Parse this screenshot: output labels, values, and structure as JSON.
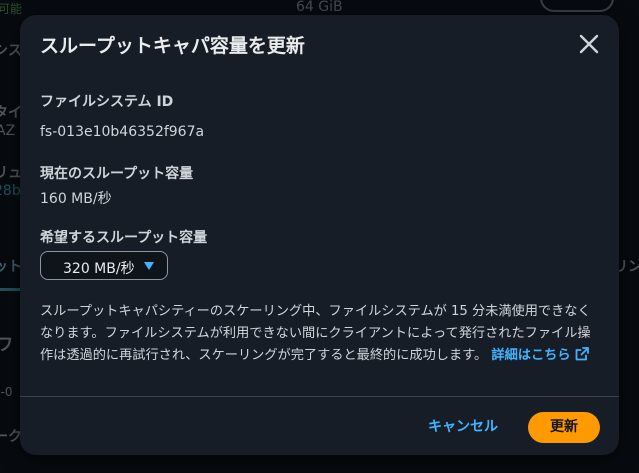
{
  "background": {
    "storage_value": "64 GiB",
    "left_fragments": [
      "可能",
      "シス",
      "タイ",
      "AZ",
      "リュ",
      "28b",
      "ット",
      "ワ",
      "c-0",
      "ーク"
    ],
    "right_fragment": "リン"
  },
  "modal": {
    "title": "スループットキャパ容量を更新",
    "close_label": "×",
    "fs_id_label": "ファイルシステム ID",
    "fs_id_value": "fs-013e10b46352f967a",
    "current_label": "現在のスループット容量",
    "current_value": "160 MB/秒",
    "desired_label": "希望するスループット容量",
    "desired_value": "320 MB/秒",
    "warning_text": "スループットキャパシティーのスケーリング中、ファイルシステムが 15 分未満使用できなくなります。ファイルシステムが利用できない間にクライアントによって発行されたファイル操作は透過的に再試行され、スケーリングが完了すると最終的に成功します。",
    "learn_more_link": "詳細はこちら",
    "cancel_label": "キャンセル",
    "update_label": "更新"
  },
  "colors": {
    "modal_bg": "#161d26",
    "accent_link": "#42b4ff",
    "primary_button": "#ff9900",
    "text": "#d1d5db"
  },
  "icons": {
    "close": "close-icon",
    "dropdown": "caret-down-icon",
    "external": "external-link-icon"
  }
}
